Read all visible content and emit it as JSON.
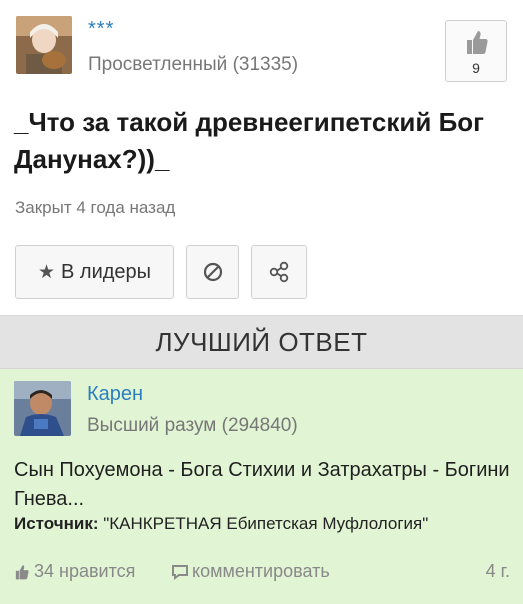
{
  "question": {
    "author": "***",
    "author_rank": "Просветленный (31335)",
    "like_count": "9",
    "title": "_Что за такой древнеегипетский Бог Данунах?))_",
    "status": "Закрыт 4 года назад"
  },
  "actions": {
    "leaders_label": "В лидеры",
    "icons": [
      "star-icon",
      "block-icon",
      "share-icon"
    ]
  },
  "best_answer": {
    "header": "ЛУЧШИЙ ОТВЕТ",
    "author": "Карен",
    "author_rank": "Высший разум (294840)",
    "text": "Сын Похуемона - Бога Стихии и Затрахатры - Богини Гнева...",
    "source_label": "Источник:",
    "source_value": " \"КАНКРЕТНАЯ Ебипетская Муфлология\"",
    "likes": "34 нравится",
    "comment_label": "комментировать",
    "time": "4 г."
  },
  "colors": {
    "link": "#2a7fbf",
    "answer_bg": "#e1f5d4",
    "best_bar_bg": "#e3e3e3"
  }
}
